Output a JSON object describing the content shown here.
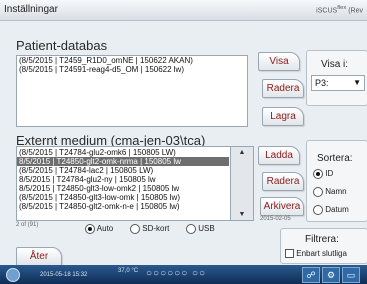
{
  "window": {
    "title": "Inställningar",
    "brand": "iSCUS",
    "brand_sup": "flex",
    "brand_suffix": "(Rev"
  },
  "patient": {
    "heading": "Patient-databas",
    "items": [
      "(8/5/2015 | T2459_R1D0_omNE | 150622 AKAN)",
      "(8/5/2015 | T24591-reag4-d5_OM | 150622 lw)"
    ],
    "buttons": {
      "show": "Visa",
      "delete": "Radera",
      "save": "Lagra"
    },
    "show_panel": {
      "label": "Visa i:",
      "selected": "P3:"
    }
  },
  "external": {
    "heading": "Externt medium (cma-jen-03\\tca)",
    "items": [
      "(8/5/2015 | T24784-glu2-omk6 | 150805 LW)",
      "8/5/2015 | T24850-glt2-omk-nrma | 150805 lw",
      "(8/5/2015 | T24784-lac2 | 150805 LW)",
      "8/5/2015 | T24784-glu2-ny | 150805 lw",
      "8/5/2015 | T24850-glt3-low-omk2 | 150805 lw",
      "(8/5/2015 | T24850-glt3-low-omk | 150805 lw)",
      "(8/5/2015 | T24850-glt2-omk-n-e | 150805 lw)"
    ],
    "selected_index": 1,
    "count": "2 of (91)",
    "sources": [
      "Auto",
      "SD-kort",
      "USB"
    ],
    "selected_source": "Auto",
    "buttons": {
      "load": "Ladda",
      "delete": "Radera",
      "archive": "Arkivera"
    },
    "archive_date": "2015-02-05",
    "sort": {
      "label": "Sortera:",
      "options": [
        "ID",
        "Namn",
        "Datum"
      ],
      "selected": "ID"
    },
    "filter": {
      "label": "Filtrera:",
      "only_final": "Enbart slutliga"
    }
  },
  "back_button": "Åter",
  "taskbar": {
    "datetime": "2015-05-18 15:32",
    "temp": "37,0 °C",
    "dots": "○○○○○○ ○○"
  }
}
